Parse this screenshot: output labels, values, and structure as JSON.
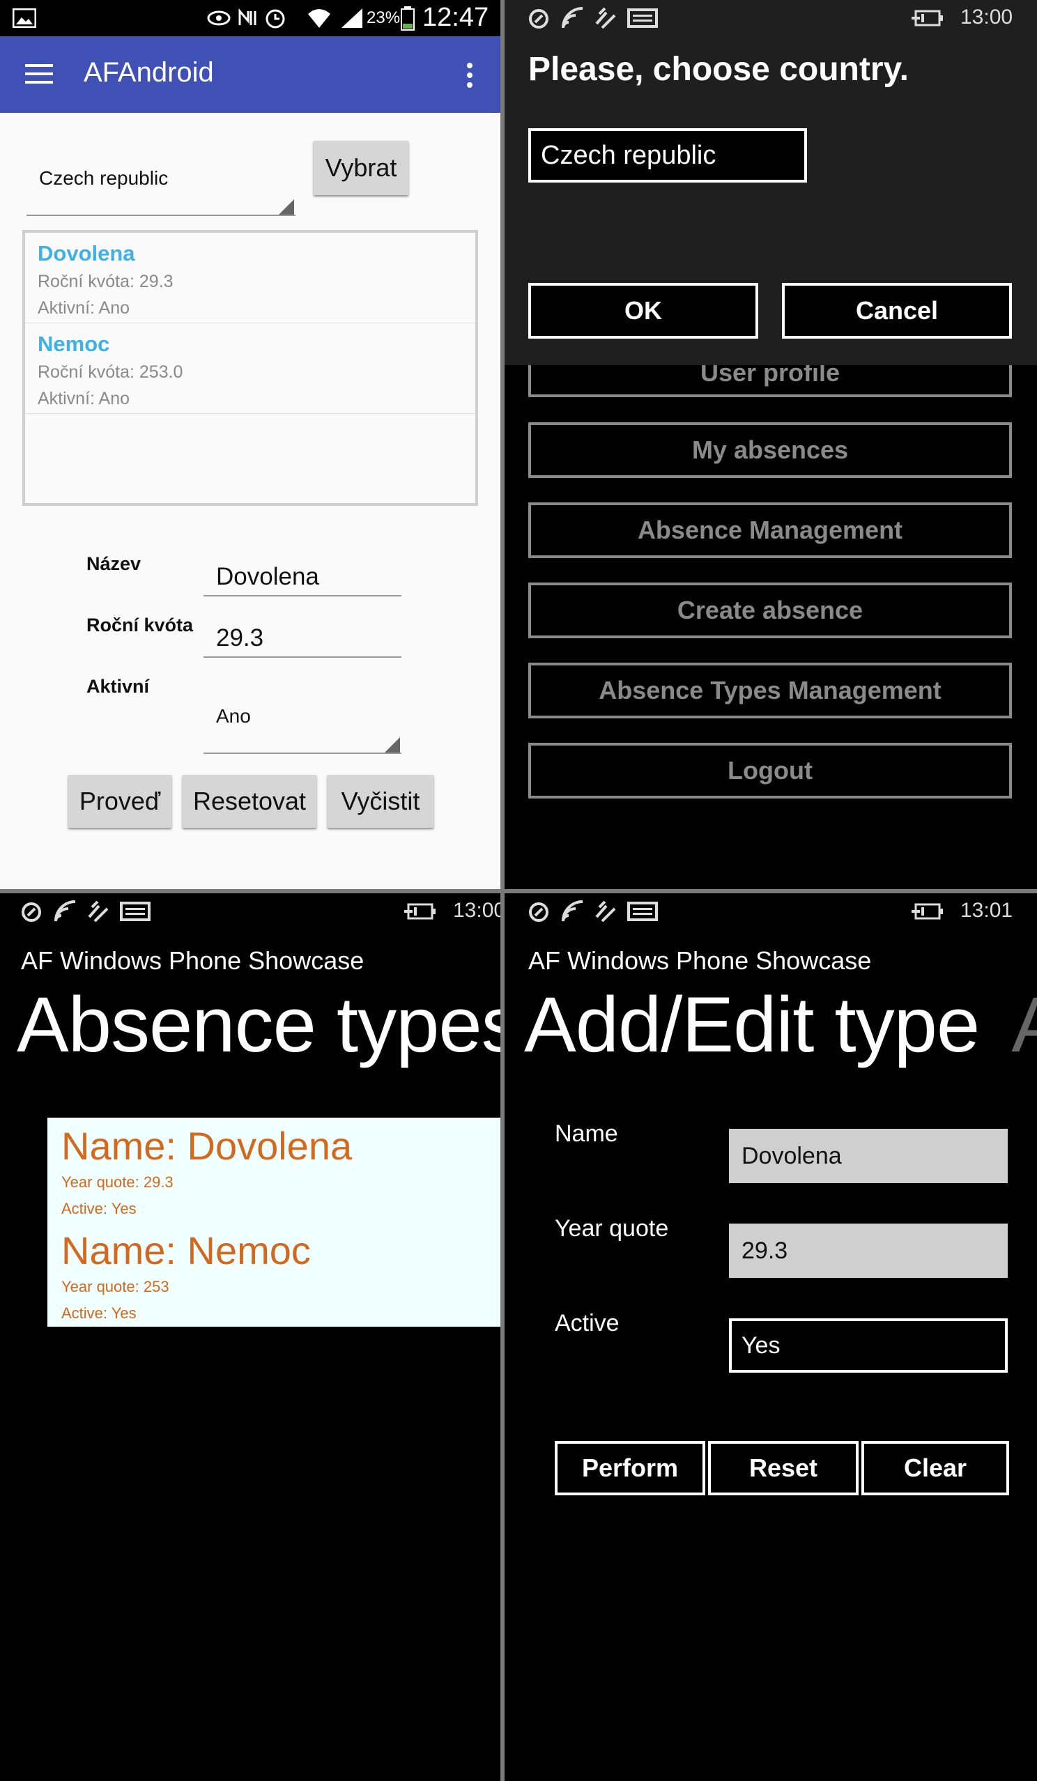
{
  "android": {
    "status_bar": {
      "battery": "23%",
      "time": "12:47"
    },
    "toolbar": {
      "title": "AFAndroid"
    },
    "country_select": {
      "value": "Czech republic"
    },
    "select_button": {
      "label": "Vybrat"
    },
    "list": [
      {
        "title": "Dovolena",
        "quota": "Roční kvóta: 29.3",
        "active": "Aktivní: Ano"
      },
      {
        "title": "Nemoc",
        "quota": "Roční kvóta: 253.0",
        "active": "Aktivní: Ano"
      }
    ],
    "form": {
      "name_label": "Název",
      "name_value": "Dovolena",
      "quota_label": "Roční kvóta",
      "quota_value": "29.3",
      "active_label": "Aktivní",
      "active_value": "Ano"
    },
    "actions": {
      "perform": "Proveď",
      "reset": "Resetovat",
      "clear": "Vyčistit"
    }
  },
  "wp_dialog": {
    "status_bar": {
      "time": "13:00"
    },
    "title": "Please, choose country.",
    "country_value": "Czech republic",
    "ok": "OK",
    "cancel": "Cancel",
    "menu": [
      "User profile",
      "My absences",
      "Absence Management",
      "Create absence",
      "Absence Types Management",
      "Logout"
    ]
  },
  "wp_types": {
    "status_bar": {
      "time": "13:00"
    },
    "app_title": "AF Windows Phone Showcase",
    "page_title": "Absence types",
    "items": [
      {
        "name": "Name: Dovolena",
        "quote": "Year quote: 29.3",
        "active": "Active: Yes"
      },
      {
        "name": "Name: Nemoc",
        "quote": "Year quote: 253",
        "active": "Active: Yes"
      }
    ]
  },
  "wp_edit": {
    "status_bar": {
      "time": "13:01"
    },
    "app_title": "AF Windows Phone Showcase",
    "page_title": "Add/Edit type",
    "page_title_next": "A",
    "name_label": "Name",
    "name_value": "Dovolena",
    "quote_label": "Year quote",
    "quote_value": "29.3",
    "active_label": "Active",
    "active_value": "Yes",
    "perform": "Perform",
    "reset": "Reset",
    "clear": "Clear"
  },
  "colors": {
    "android_toolbar": "#3f51b5",
    "android_list_title": "#3fb0e8",
    "wp_item_text": "#d2691e",
    "wp_list_bg": "#f0ffff"
  }
}
